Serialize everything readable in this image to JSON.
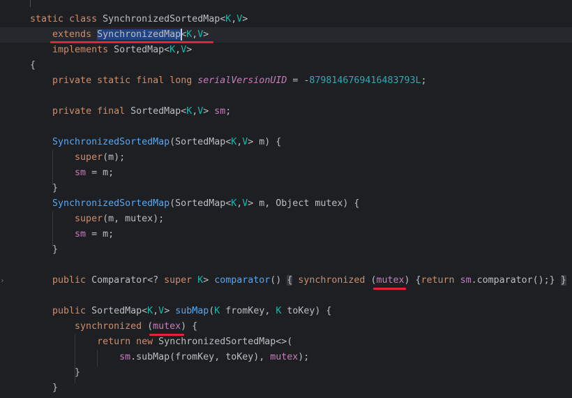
{
  "lines": [
    {
      "name": "code-line-1",
      "tokens": [
        {
          "t": "static",
          "c": "kw"
        },
        {
          "t": " "
        },
        {
          "t": "class",
          "c": "kw"
        },
        {
          "t": " SynchronizedSortedMap<"
        },
        {
          "t": "K",
          "c": "tp"
        },
        {
          "t": ","
        },
        {
          "t": "V",
          "c": "tp"
        },
        {
          "t": ">"
        }
      ]
    },
    {
      "name": "code-line-2",
      "tokens": [
        {
          "t": "    "
        },
        {
          "t": "extends",
          "c": "kw"
        },
        {
          "t": " "
        },
        {
          "t": "SynchronizedMap",
          "c": "sel"
        },
        {
          "caret": true
        },
        {
          "t": "<"
        },
        {
          "t": "K",
          "c": "tp"
        },
        {
          "t": ","
        },
        {
          "t": "V",
          "c": "tp"
        },
        {
          "t": ">"
        }
      ]
    },
    {
      "name": "code-line-3",
      "tokens": [
        {
          "t": "    "
        },
        {
          "t": "implements",
          "c": "kw"
        },
        {
          "t": " SortedMap<"
        },
        {
          "t": "K",
          "c": "tp"
        },
        {
          "t": ","
        },
        {
          "t": "V",
          "c": "tp"
        },
        {
          "t": ">"
        }
      ]
    },
    {
      "name": "code-line-4",
      "tokens": [
        {
          "t": "{"
        }
      ]
    },
    {
      "name": "code-line-5",
      "tokens": [
        {
          "t": "    "
        },
        {
          "t": "private",
          "c": "kw"
        },
        {
          "t": " "
        },
        {
          "t": "static",
          "c": "kw"
        },
        {
          "t": " "
        },
        {
          "t": "final",
          "c": "kw"
        },
        {
          "t": " "
        },
        {
          "t": "long",
          "c": "kw"
        },
        {
          "t": " "
        },
        {
          "t": "serialVersionUID",
          "c": "cst"
        },
        {
          "t": " = -"
        },
        {
          "t": "8798146769416483793L",
          "c": "num"
        },
        {
          "t": ";"
        }
      ]
    },
    {
      "name": "code-line-6",
      "tokens": []
    },
    {
      "name": "code-line-7",
      "tokens": [
        {
          "t": "    "
        },
        {
          "t": "private",
          "c": "kw"
        },
        {
          "t": " "
        },
        {
          "t": "final",
          "c": "kw"
        },
        {
          "t": " SortedMap<"
        },
        {
          "t": "K",
          "c": "tp"
        },
        {
          "t": ","
        },
        {
          "t": "V",
          "c": "tp"
        },
        {
          "t": "> "
        },
        {
          "t": "sm",
          "c": "fld"
        },
        {
          "t": ";"
        }
      ]
    },
    {
      "name": "code-line-8",
      "tokens": []
    },
    {
      "name": "code-line-9",
      "tokens": [
        {
          "t": "    "
        },
        {
          "t": "SynchronizedSortedMap",
          "c": "fn"
        },
        {
          "t": "(SortedMap<"
        },
        {
          "t": "K",
          "c": "tp"
        },
        {
          "t": ","
        },
        {
          "t": "V",
          "c": "tp"
        },
        {
          "t": "> m) {"
        }
      ]
    },
    {
      "name": "code-line-10",
      "tokens": [
        {
          "t": "        "
        },
        {
          "t": "super",
          "c": "kw"
        },
        {
          "t": "(m);"
        }
      ]
    },
    {
      "name": "code-line-11",
      "tokens": [
        {
          "t": "        "
        },
        {
          "t": "sm",
          "c": "fld"
        },
        {
          "t": " = m;"
        }
      ]
    },
    {
      "name": "code-line-12",
      "tokens": [
        {
          "t": "    }"
        }
      ]
    },
    {
      "name": "code-line-13",
      "tokens": [
        {
          "t": "    "
        },
        {
          "t": "SynchronizedSortedMap",
          "c": "fn"
        },
        {
          "t": "(SortedMap<"
        },
        {
          "t": "K",
          "c": "tp"
        },
        {
          "t": ","
        },
        {
          "t": "V",
          "c": "tp"
        },
        {
          "t": "> m, Object mutex) {"
        }
      ]
    },
    {
      "name": "code-line-14",
      "tokens": [
        {
          "t": "        "
        },
        {
          "t": "super",
          "c": "kw"
        },
        {
          "t": "(m, mutex);"
        }
      ]
    },
    {
      "name": "code-line-15",
      "tokens": [
        {
          "t": "        "
        },
        {
          "t": "sm",
          "c": "fld"
        },
        {
          "t": " = m;"
        }
      ]
    },
    {
      "name": "code-line-16",
      "tokens": [
        {
          "t": "    }"
        }
      ]
    },
    {
      "name": "code-line-17",
      "tokens": []
    },
    {
      "name": "code-line-18",
      "tokens": [
        {
          "t": "    "
        },
        {
          "t": "public",
          "c": "kw"
        },
        {
          "t": " Comparator<? "
        },
        {
          "t": "super",
          "c": "kw"
        },
        {
          "t": " "
        },
        {
          "t": "K",
          "c": "tp"
        },
        {
          "t": "> "
        },
        {
          "t": "comparator",
          "c": "fn"
        },
        {
          "t": "() "
        },
        {
          "t": "{",
          "c": "foldbox"
        },
        {
          "t": " "
        },
        {
          "t": "synchronized",
          "c": "kw"
        },
        {
          "t": " ("
        },
        {
          "t": "mutex",
          "c": "fld"
        },
        {
          "t": ") {"
        },
        {
          "t": "return",
          "c": "kw"
        },
        {
          "t": " "
        },
        {
          "t": "sm",
          "c": "fld"
        },
        {
          "t": ".comparator();} "
        },
        {
          "t": "}",
          "c": "foldbox"
        }
      ]
    },
    {
      "name": "code-line-19",
      "tokens": []
    },
    {
      "name": "code-line-20",
      "tokens": [
        {
          "t": "    "
        },
        {
          "t": "public",
          "c": "kw"
        },
        {
          "t": " SortedMap<"
        },
        {
          "t": "K",
          "c": "tp"
        },
        {
          "t": ","
        },
        {
          "t": "V",
          "c": "tp"
        },
        {
          "t": "> "
        },
        {
          "t": "subMap",
          "c": "fn"
        },
        {
          "t": "("
        },
        {
          "t": "K",
          "c": "tp"
        },
        {
          "t": " fromKey, "
        },
        {
          "t": "K",
          "c": "tp"
        },
        {
          "t": " toKey) {"
        }
      ]
    },
    {
      "name": "code-line-21",
      "tokens": [
        {
          "t": "        "
        },
        {
          "t": "synchronized",
          "c": "kw"
        },
        {
          "t": " ("
        },
        {
          "t": "mutex",
          "c": "fld"
        },
        {
          "t": ") {"
        }
      ]
    },
    {
      "name": "code-line-22",
      "tokens": [
        {
          "t": "            "
        },
        {
          "t": "return",
          "c": "kw"
        },
        {
          "t": " "
        },
        {
          "t": "new",
          "c": "kw"
        },
        {
          "t": " SynchronizedSortedMap<>("
        }
      ]
    },
    {
      "name": "code-line-23",
      "tokens": [
        {
          "t": "                "
        },
        {
          "t": "sm",
          "c": "fld"
        },
        {
          "t": ".subMap(fromKey, toKey), "
        },
        {
          "t": "mutex",
          "c": "fld"
        },
        {
          "t": ");"
        }
      ]
    },
    {
      "name": "code-line-24",
      "tokens": [
        {
          "t": "        }"
        }
      ]
    },
    {
      "name": "code-line-25",
      "tokens": [
        {
          "t": "    }"
        }
      ]
    }
  ],
  "colors": {
    "background": "#1e1f22",
    "keyword": "#cf8e6d",
    "type_parameter": "#16baac",
    "method": "#56a8f5",
    "field": "#c77dbb",
    "number": "#2aacb8",
    "selection": "#214283",
    "annotation_underline": "#e8222f"
  }
}
